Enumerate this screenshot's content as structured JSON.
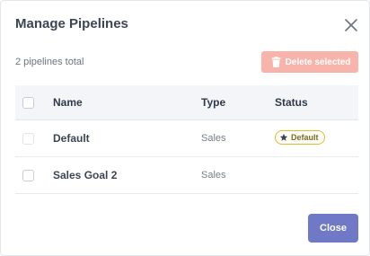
{
  "modal": {
    "title": "Manage Pipelines",
    "total_text": "2 pipelines total",
    "delete_label": "Delete selected",
    "close_label": "Close"
  },
  "table": {
    "headers": {
      "name": "Name",
      "type": "Type",
      "status": "Status"
    },
    "rows": [
      {
        "name": "Default",
        "type": "Sales",
        "status": "Default"
      },
      {
        "name": "Sales Goal 2",
        "type": "Sales",
        "status": ""
      }
    ]
  },
  "colors": {
    "delete_button": "#f8b3aa",
    "close_button": "#6f79c6",
    "badge_border": "#e2b93b"
  },
  "icons": {
    "close": "close-icon",
    "trash": "trash-icon",
    "star": "star-icon"
  }
}
